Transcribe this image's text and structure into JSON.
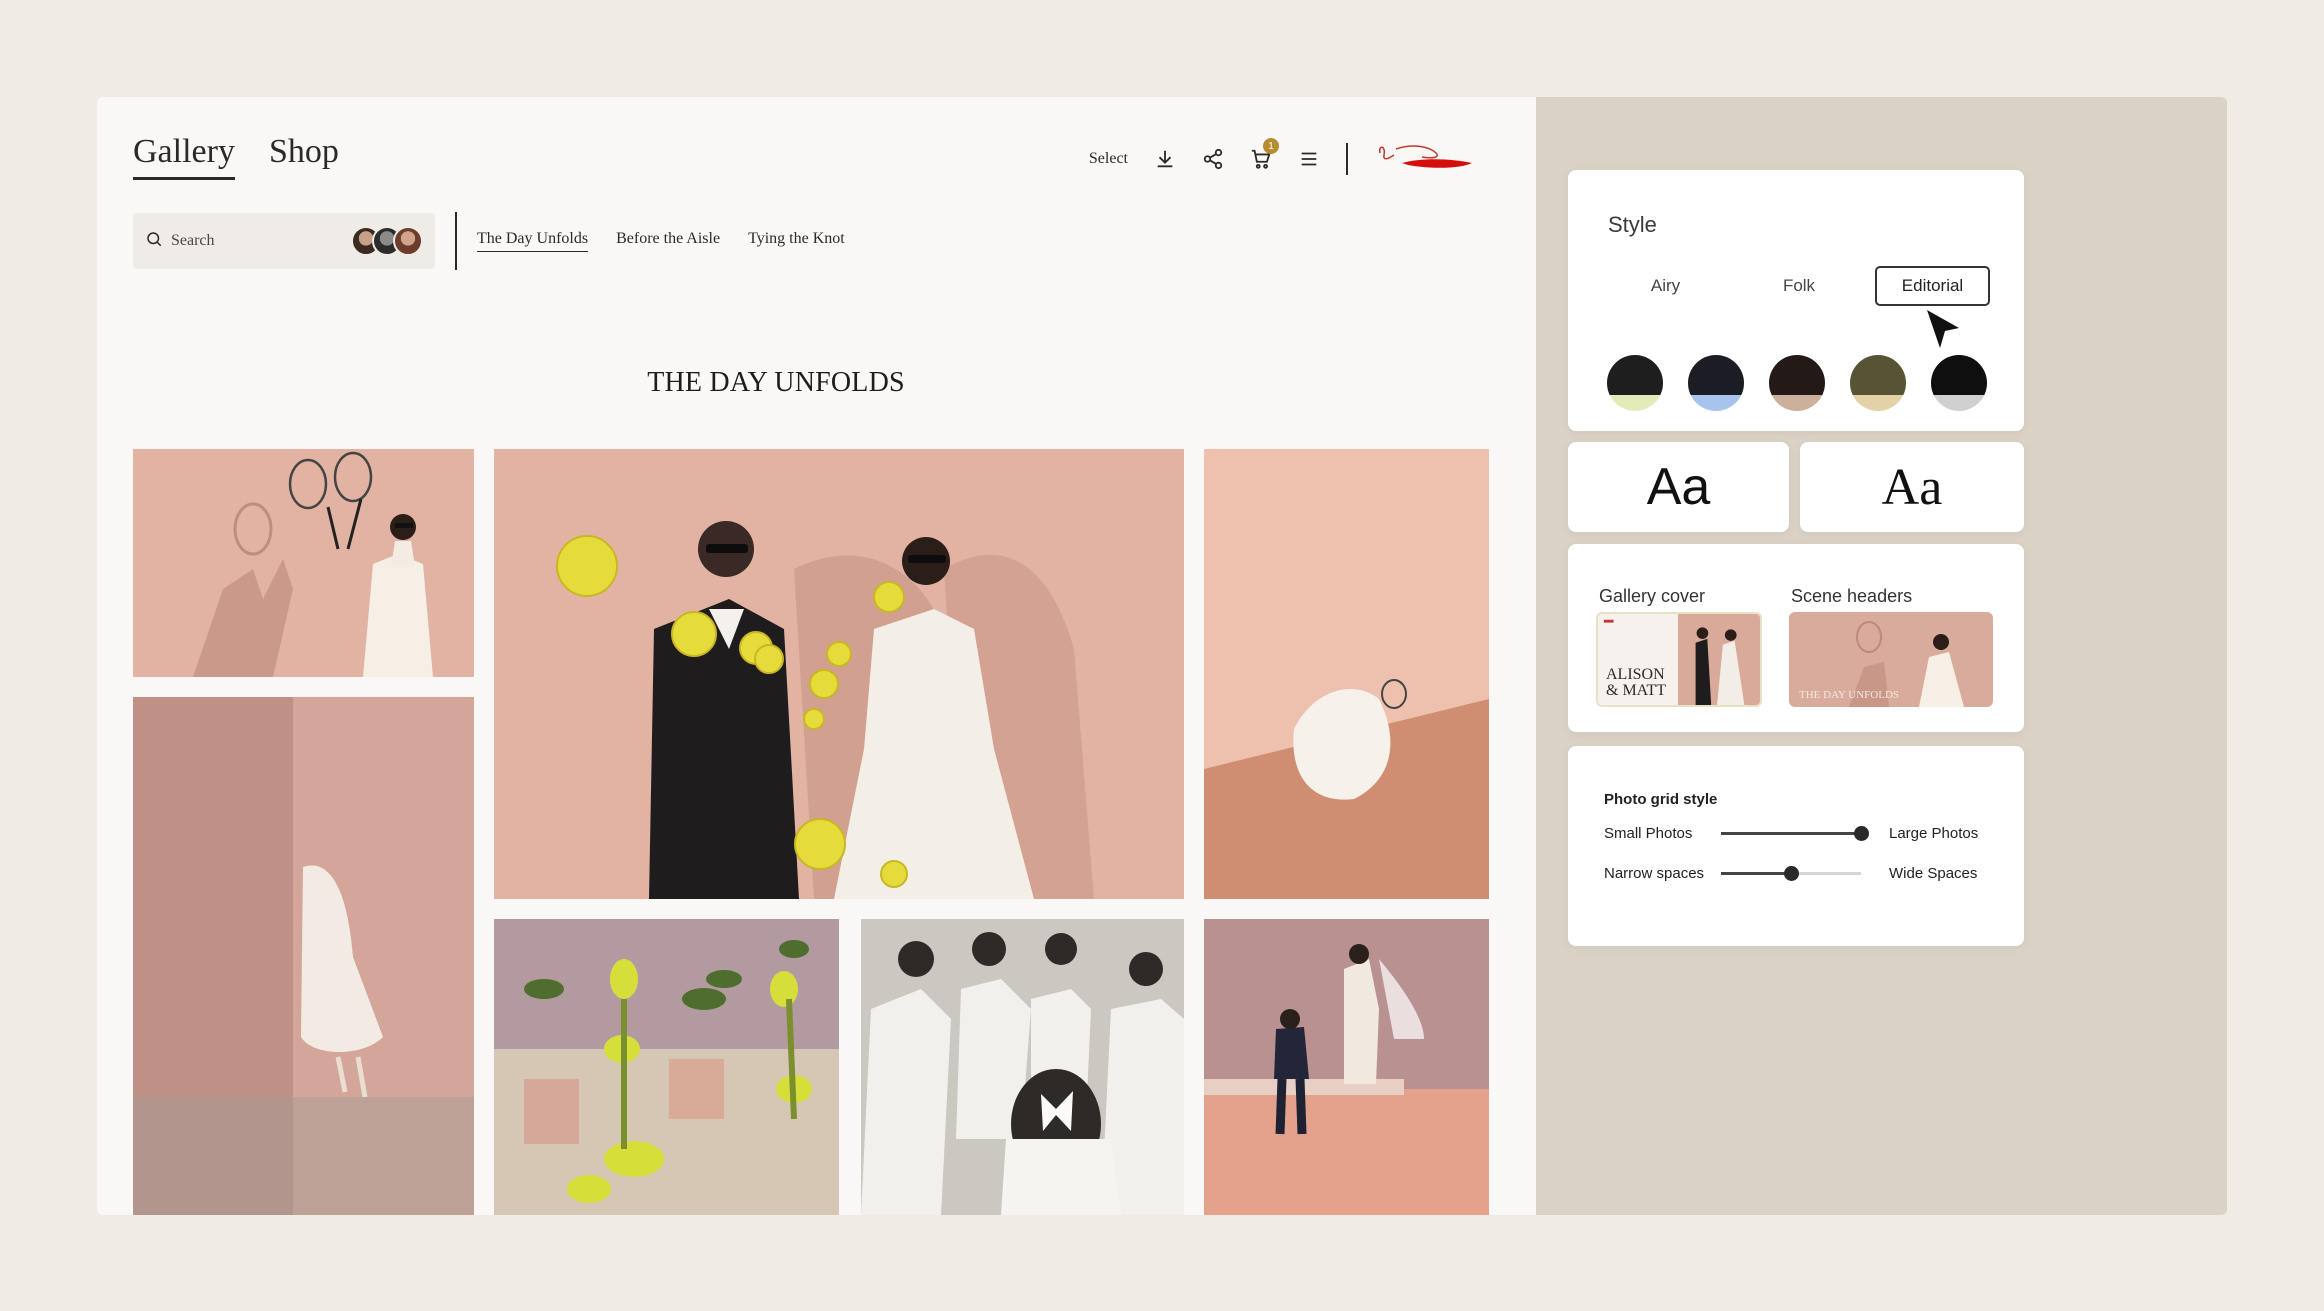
{
  "nav": {
    "tabs": [
      {
        "label": "Gallery",
        "active": true
      },
      {
        "label": "Shop",
        "active": false
      }
    ]
  },
  "toolbar": {
    "select_label": "Select",
    "cart_count": "1",
    "icons": [
      "download-icon",
      "share-icon",
      "cart-icon",
      "menu-icon"
    ]
  },
  "search": {
    "placeholder": "Search"
  },
  "scenes": {
    "tabs": [
      {
        "label": "The Day Unfolds",
        "active": true
      },
      {
        "label": "Before the Aisle",
        "active": false
      },
      {
        "label": "Tying the Knot",
        "active": false
      }
    ]
  },
  "main": {
    "scene_title": "THE DAY UNFOLDS"
  },
  "style_panel": {
    "heading": "Style",
    "options": [
      {
        "label": "Airy",
        "active": false
      },
      {
        "label": "Folk",
        "active": false
      },
      {
        "label": "Editorial",
        "active": true
      }
    ],
    "swatches": [
      {
        "top": "#1e1e1e",
        "bottom": "#e3ecb8"
      },
      {
        "top": "#1c1d24",
        "bottom": "#a9c4ec"
      },
      {
        "top": "#231a17",
        "bottom": "#cdb09c"
      },
      {
        "top": "#575335",
        "bottom": "#e3d2a8"
      },
      {
        "top": "#0f0f0f",
        "bottom": "#d0d0d0"
      }
    ]
  },
  "fonts": {
    "sans_sample": "Aa",
    "serif_sample": "Aa"
  },
  "layout_panel": {
    "cover_label": "Gallery cover",
    "headers_label": "Scene headers",
    "cover_text": "ALISON\n& MATT",
    "header_text": "THE DAY UNFOLDS"
  },
  "grid_panel": {
    "heading": "Photo grid style",
    "size": {
      "left": "Small Photos",
      "right": "Large Photos",
      "value": 1.0
    },
    "spacing": {
      "left": "Narrow spaces",
      "right": "Wide Spaces",
      "value": 0.5
    }
  },
  "colors": {
    "accent": "#2d2926",
    "badge": "#b58d2e",
    "background": "#f0ebe5"
  }
}
